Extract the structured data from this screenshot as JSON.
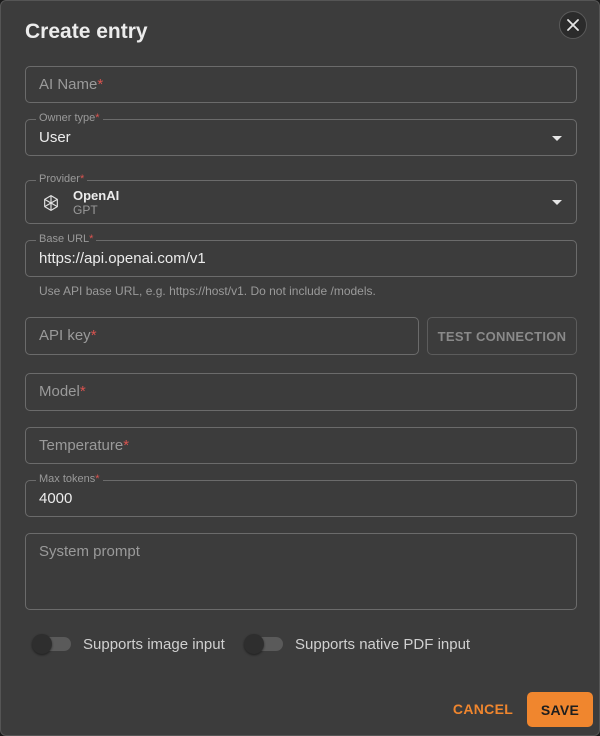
{
  "dialog": {
    "title": "Create entry",
    "close_icon": "close-icon"
  },
  "fields": {
    "ai_name": {
      "placeholder": "AI Name",
      "required_mark": "*"
    },
    "owner_type": {
      "label": "Owner type",
      "required_mark": "*",
      "value": "User"
    },
    "provider": {
      "label": "Provider",
      "required_mark": "*",
      "name": "OpenAI",
      "subtitle": "GPT",
      "icon": "openai-logo-icon"
    },
    "base_url": {
      "label": "Base URL",
      "required_mark": "*",
      "value": "https://api.openai.com/v1",
      "helper": "Use API base URL, e.g. https://host/v1. Do not include /models."
    },
    "api_key": {
      "placeholder": "API key",
      "required_mark": "*"
    },
    "test_connection": {
      "label": "TEST CONNECTION"
    },
    "model": {
      "placeholder": "Model",
      "required_mark": "*"
    },
    "temperature": {
      "placeholder": "Temperature",
      "required_mark": "*"
    },
    "max_tokens": {
      "label": "Max tokens",
      "required_mark": "*",
      "value": "4000"
    },
    "system_prompt": {
      "placeholder": "System prompt"
    }
  },
  "toggles": {
    "image_input": {
      "label": "Supports image input",
      "enabled": false
    },
    "pdf_input": {
      "label": "Supports native PDF input",
      "enabled": false
    }
  },
  "actions": {
    "cancel": "CANCEL",
    "save": "SAVE"
  },
  "colors": {
    "accent": "#f0862e",
    "required": "#d9534f",
    "background": "#3c3c3c"
  }
}
